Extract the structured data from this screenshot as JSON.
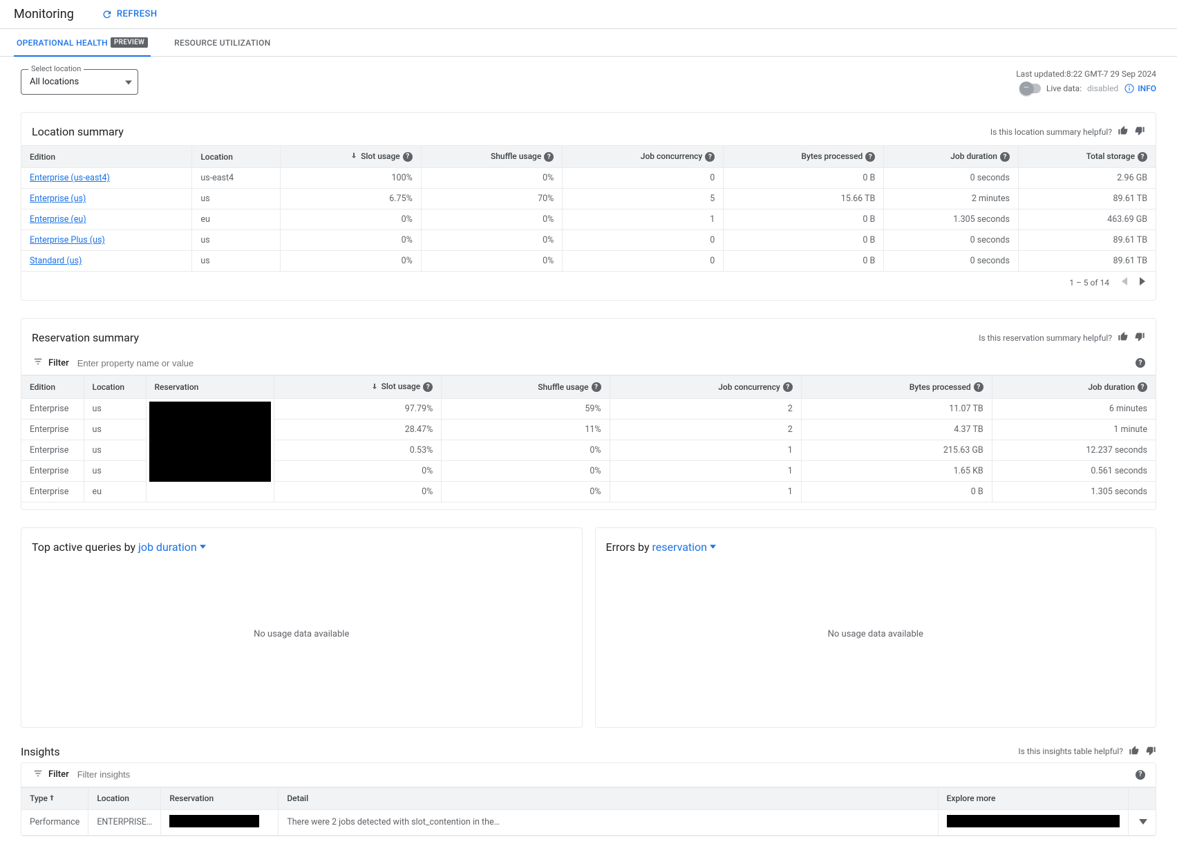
{
  "header": {
    "title": "Monitoring",
    "refresh": "REFRESH"
  },
  "tabs": {
    "operational_health": "OPERATIONAL HEALTH",
    "preview_badge": "PREVIEW",
    "resource_utilization": "RESOURCE UTILIZATION"
  },
  "location_select": {
    "label": "Select location",
    "value": "All locations"
  },
  "status": {
    "last_updated_label": "Last updated:",
    "last_updated_value": "8:22 GMT-7 29 Sep 2024",
    "live_data_label": "Live data:",
    "live_data_state": "disabled",
    "info": "INFO"
  },
  "location_summary": {
    "title": "Location summary",
    "feedback_prompt": "Is this location summary helpful?",
    "columns": {
      "edition": "Edition",
      "location": "Location",
      "slot_usage": "Slot usage",
      "shuffle_usage": "Shuffle usage",
      "job_concurrency": "Job concurrency",
      "bytes_processed": "Bytes processed",
      "job_duration": "Job duration",
      "total_storage": "Total storage"
    },
    "rows": [
      {
        "edition": "Enterprise (us-east4)",
        "location": "us-east4",
        "slot_usage": "100%",
        "shuffle_usage": "0%",
        "job_concurrency": "0",
        "bytes_processed": "0 B",
        "job_duration": "0 seconds",
        "total_storage": "2.96 GB"
      },
      {
        "edition": "Enterprise (us)",
        "location": "us",
        "slot_usage": "6.75%",
        "shuffle_usage": "70%",
        "job_concurrency": "5",
        "bytes_processed": "15.66 TB",
        "job_duration": "2 minutes",
        "total_storage": "89.61 TB"
      },
      {
        "edition": "Enterprise (eu)",
        "location": "eu",
        "slot_usage": "0%",
        "shuffle_usage": "0%",
        "job_concurrency": "1",
        "bytes_processed": "0 B",
        "job_duration": "1.305 seconds",
        "total_storage": "463.69 GB"
      },
      {
        "edition": "Enterprise Plus (us)",
        "location": "us",
        "slot_usage": "0%",
        "shuffle_usage": "0%",
        "job_concurrency": "0",
        "bytes_processed": "0 B",
        "job_duration": "0 seconds",
        "total_storage": "89.61 TB"
      },
      {
        "edition": "Standard (us)",
        "location": "us",
        "slot_usage": "0%",
        "shuffle_usage": "0%",
        "job_concurrency": "0",
        "bytes_processed": "0 B",
        "job_duration": "0 seconds",
        "total_storage": "89.61 TB"
      }
    ],
    "pagination": "1 – 5 of 14"
  },
  "reservation_summary": {
    "title": "Reservation summary",
    "feedback_prompt": "Is this reservation summary helpful?",
    "filter_label": "Filter",
    "filter_placeholder": "Enter property name or value",
    "columns": {
      "edition": "Edition",
      "location": "Location",
      "reservation": "Reservation",
      "slot_usage": "Slot usage",
      "shuffle_usage": "Shuffle usage",
      "job_concurrency": "Job concurrency",
      "bytes_processed": "Bytes processed",
      "job_duration": "Job duration"
    },
    "rows": [
      {
        "edition": "Enterprise",
        "location": "us",
        "slot_usage": "97.79%",
        "shuffle_usage": "59%",
        "job_concurrency": "2",
        "bytes_processed": "11.07 TB",
        "job_duration": "6 minutes"
      },
      {
        "edition": "Enterprise",
        "location": "us",
        "slot_usage": "28.47%",
        "shuffle_usage": "11%",
        "job_concurrency": "2",
        "bytes_processed": "4.37 TB",
        "job_duration": "1 minute"
      },
      {
        "edition": "Enterprise",
        "location": "us",
        "slot_usage": "0.53%",
        "shuffle_usage": "0%",
        "job_concurrency": "1",
        "bytes_processed": "215.63 GB",
        "job_duration": "12.237 seconds"
      },
      {
        "edition": "Enterprise",
        "location": "us",
        "slot_usage": "0%",
        "shuffle_usage": "0%",
        "job_concurrency": "1",
        "bytes_processed": "1.65 KB",
        "job_duration": "0.561 seconds"
      },
      {
        "edition": "Enterprise",
        "location": "eu",
        "slot_usage": "0%",
        "shuffle_usage": "0%",
        "job_concurrency": "1",
        "bytes_processed": "0 B",
        "job_duration": "1.305 seconds"
      }
    ]
  },
  "top_active": {
    "prefix": "Top active queries by ",
    "dimension": "job duration",
    "empty": "No usage data available"
  },
  "errors_by": {
    "prefix": "Errors by ",
    "dimension": "reservation",
    "empty": "No usage data available"
  },
  "insights": {
    "title": "Insights",
    "feedback_prompt": "Is this insights table helpful?",
    "filter_label": "Filter",
    "filter_placeholder": "Filter insights",
    "columns": {
      "type": "Type",
      "location": "Location",
      "reservation": "Reservation",
      "detail": "Detail",
      "explore_more": "Explore more"
    },
    "rows": [
      {
        "type": "Performance",
        "location": "ENTERPRISE…",
        "detail": "There were 2 jobs detected with slot_contention in the…"
      }
    ]
  }
}
